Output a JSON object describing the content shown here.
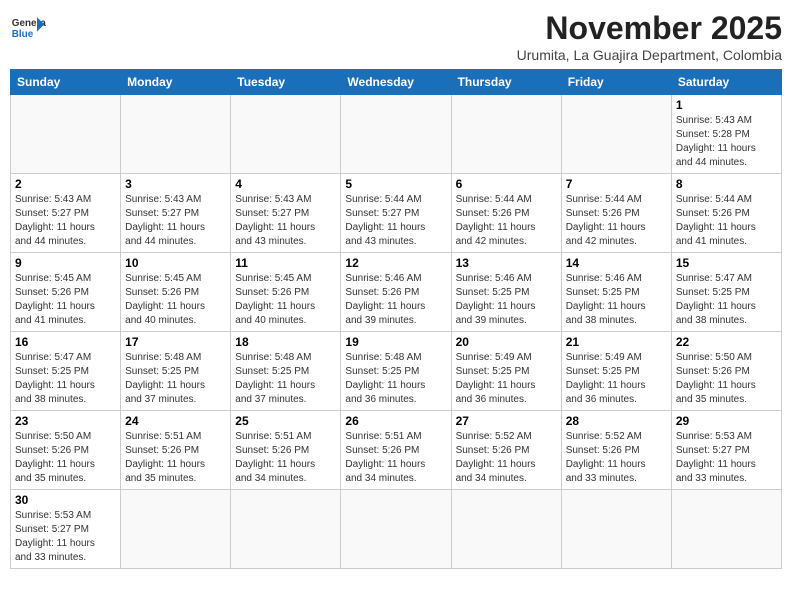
{
  "logo": {
    "general": "General",
    "blue": "Blue"
  },
  "header": {
    "month_year": "November 2025",
    "location": "Urumita, La Guajira Department, Colombia"
  },
  "weekdays": [
    "Sunday",
    "Monday",
    "Tuesday",
    "Wednesday",
    "Thursday",
    "Friday",
    "Saturday"
  ],
  "weeks": [
    [
      {
        "day": "",
        "info": ""
      },
      {
        "day": "",
        "info": ""
      },
      {
        "day": "",
        "info": ""
      },
      {
        "day": "",
        "info": ""
      },
      {
        "day": "",
        "info": ""
      },
      {
        "day": "",
        "info": ""
      },
      {
        "day": "1",
        "info": "Sunrise: 5:43 AM\nSunset: 5:28 PM\nDaylight: 11 hours\nand 44 minutes."
      }
    ],
    [
      {
        "day": "2",
        "info": "Sunrise: 5:43 AM\nSunset: 5:27 PM\nDaylight: 11 hours\nand 44 minutes."
      },
      {
        "day": "3",
        "info": "Sunrise: 5:43 AM\nSunset: 5:27 PM\nDaylight: 11 hours\nand 44 minutes."
      },
      {
        "day": "4",
        "info": "Sunrise: 5:43 AM\nSunset: 5:27 PM\nDaylight: 11 hours\nand 43 minutes."
      },
      {
        "day": "5",
        "info": "Sunrise: 5:44 AM\nSunset: 5:27 PM\nDaylight: 11 hours\nand 43 minutes."
      },
      {
        "day": "6",
        "info": "Sunrise: 5:44 AM\nSunset: 5:26 PM\nDaylight: 11 hours\nand 42 minutes."
      },
      {
        "day": "7",
        "info": "Sunrise: 5:44 AM\nSunset: 5:26 PM\nDaylight: 11 hours\nand 42 minutes."
      },
      {
        "day": "8",
        "info": "Sunrise: 5:44 AM\nSunset: 5:26 PM\nDaylight: 11 hours\nand 41 minutes."
      }
    ],
    [
      {
        "day": "9",
        "info": "Sunrise: 5:45 AM\nSunset: 5:26 PM\nDaylight: 11 hours\nand 41 minutes."
      },
      {
        "day": "10",
        "info": "Sunrise: 5:45 AM\nSunset: 5:26 PM\nDaylight: 11 hours\nand 40 minutes."
      },
      {
        "day": "11",
        "info": "Sunrise: 5:45 AM\nSunset: 5:26 PM\nDaylight: 11 hours\nand 40 minutes."
      },
      {
        "day": "12",
        "info": "Sunrise: 5:46 AM\nSunset: 5:26 PM\nDaylight: 11 hours\nand 39 minutes."
      },
      {
        "day": "13",
        "info": "Sunrise: 5:46 AM\nSunset: 5:25 PM\nDaylight: 11 hours\nand 39 minutes."
      },
      {
        "day": "14",
        "info": "Sunrise: 5:46 AM\nSunset: 5:25 PM\nDaylight: 11 hours\nand 38 minutes."
      },
      {
        "day": "15",
        "info": "Sunrise: 5:47 AM\nSunset: 5:25 PM\nDaylight: 11 hours\nand 38 minutes."
      }
    ],
    [
      {
        "day": "16",
        "info": "Sunrise: 5:47 AM\nSunset: 5:25 PM\nDaylight: 11 hours\nand 38 minutes."
      },
      {
        "day": "17",
        "info": "Sunrise: 5:48 AM\nSunset: 5:25 PM\nDaylight: 11 hours\nand 37 minutes."
      },
      {
        "day": "18",
        "info": "Sunrise: 5:48 AM\nSunset: 5:25 PM\nDaylight: 11 hours\nand 37 minutes."
      },
      {
        "day": "19",
        "info": "Sunrise: 5:48 AM\nSunset: 5:25 PM\nDaylight: 11 hours\nand 36 minutes."
      },
      {
        "day": "20",
        "info": "Sunrise: 5:49 AM\nSunset: 5:25 PM\nDaylight: 11 hours\nand 36 minutes."
      },
      {
        "day": "21",
        "info": "Sunrise: 5:49 AM\nSunset: 5:25 PM\nDaylight: 11 hours\nand 36 minutes."
      },
      {
        "day": "22",
        "info": "Sunrise: 5:50 AM\nSunset: 5:26 PM\nDaylight: 11 hours\nand 35 minutes."
      }
    ],
    [
      {
        "day": "23",
        "info": "Sunrise: 5:50 AM\nSunset: 5:26 PM\nDaylight: 11 hours\nand 35 minutes."
      },
      {
        "day": "24",
        "info": "Sunrise: 5:51 AM\nSunset: 5:26 PM\nDaylight: 11 hours\nand 35 minutes."
      },
      {
        "day": "25",
        "info": "Sunrise: 5:51 AM\nSunset: 5:26 PM\nDaylight: 11 hours\nand 34 minutes."
      },
      {
        "day": "26",
        "info": "Sunrise: 5:51 AM\nSunset: 5:26 PM\nDaylight: 11 hours\nand 34 minutes."
      },
      {
        "day": "27",
        "info": "Sunrise: 5:52 AM\nSunset: 5:26 PM\nDaylight: 11 hours\nand 34 minutes."
      },
      {
        "day": "28",
        "info": "Sunrise: 5:52 AM\nSunset: 5:26 PM\nDaylight: 11 hours\nand 33 minutes."
      },
      {
        "day": "29",
        "info": "Sunrise: 5:53 AM\nSunset: 5:27 PM\nDaylight: 11 hours\nand 33 minutes."
      }
    ],
    [
      {
        "day": "30",
        "info": "Sunrise: 5:53 AM\nSunset: 5:27 PM\nDaylight: 11 hours\nand 33 minutes."
      },
      {
        "day": "",
        "info": ""
      },
      {
        "day": "",
        "info": ""
      },
      {
        "day": "",
        "info": ""
      },
      {
        "day": "",
        "info": ""
      },
      {
        "day": "",
        "info": ""
      },
      {
        "day": "",
        "info": ""
      }
    ]
  ]
}
